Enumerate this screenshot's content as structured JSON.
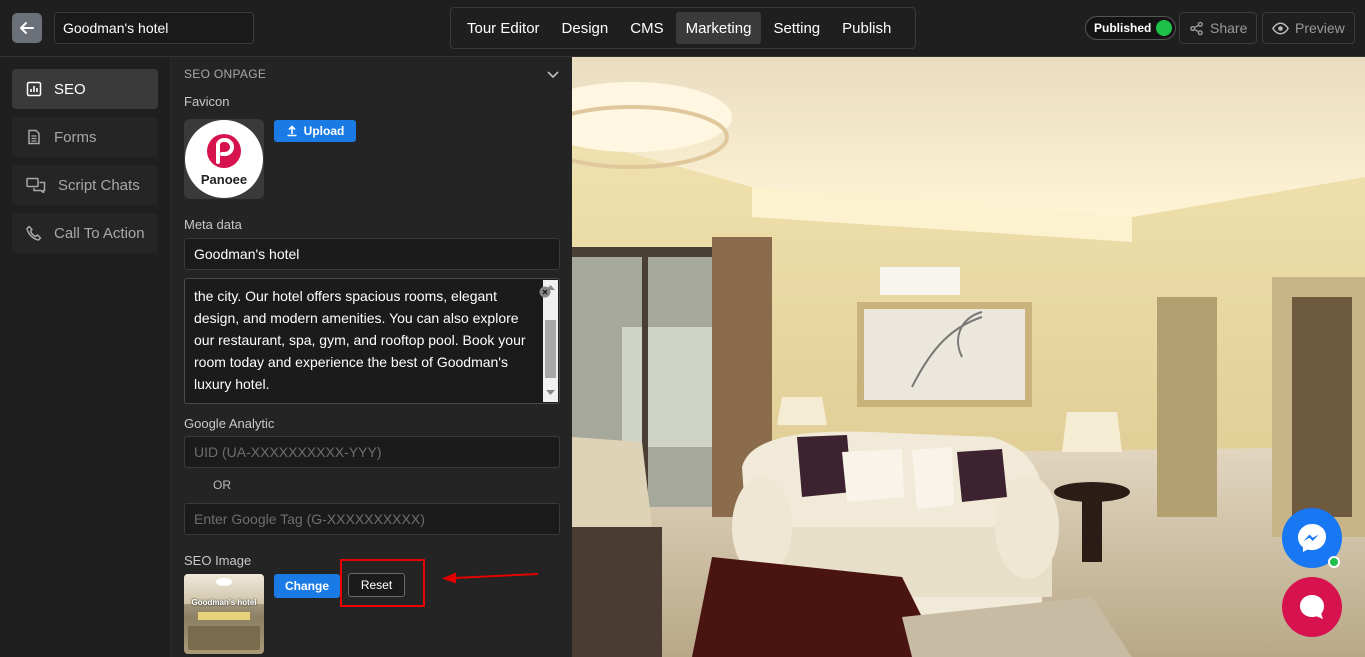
{
  "header": {
    "tour_title": "Goodman's hotel",
    "tabs": [
      {
        "label": "Tour Editor"
      },
      {
        "label": "Design"
      },
      {
        "label": "CMS"
      },
      {
        "label": "Marketing",
        "active": true
      },
      {
        "label": "Setting"
      },
      {
        "label": "Publish"
      }
    ],
    "status": "Published",
    "share": "Share",
    "preview": "Preview"
  },
  "sidebar": {
    "items": [
      {
        "label": "SEO",
        "icon": "bar-chart-icon",
        "active": true
      },
      {
        "label": "Forms",
        "icon": "document-icon"
      },
      {
        "label": "Script Chats",
        "icon": "chat-icon"
      },
      {
        "label": "Call To Action",
        "icon": "phone-icon"
      }
    ]
  },
  "seo": {
    "section_title": "SEO ONPAGE",
    "favicon_label": "Favicon",
    "favicon_logo_text": "Panoee",
    "upload_label": "Upload",
    "meta_label": "Meta data",
    "meta_title": "Goodman's hotel",
    "meta_description": "the city. Our hotel offers spacious rooms, elegant design, and modern amenities. You can also explore our restaurant, spa, gym, and rooftop pool. Book your room today and experience the best of Goodman's luxury hotel.",
    "analytics_label": "Google Analytic",
    "uid_placeholder": "UID (UA-XXXXXXXXXX-YYY)",
    "or_label": "OR",
    "gtag_placeholder": "Enter Google Tag (G-XXXXXXXXXX)",
    "seo_image_label": "SEO Image",
    "seo_image_caption": "Goodman's hotel",
    "change_label": "Change",
    "reset_label": "Reset"
  },
  "colors": {
    "accent": "#1a7be6",
    "published_dot": "#1fbf4b",
    "highlight": "#e00000",
    "messenger": "#1877f2",
    "chat": "#d6124f"
  }
}
